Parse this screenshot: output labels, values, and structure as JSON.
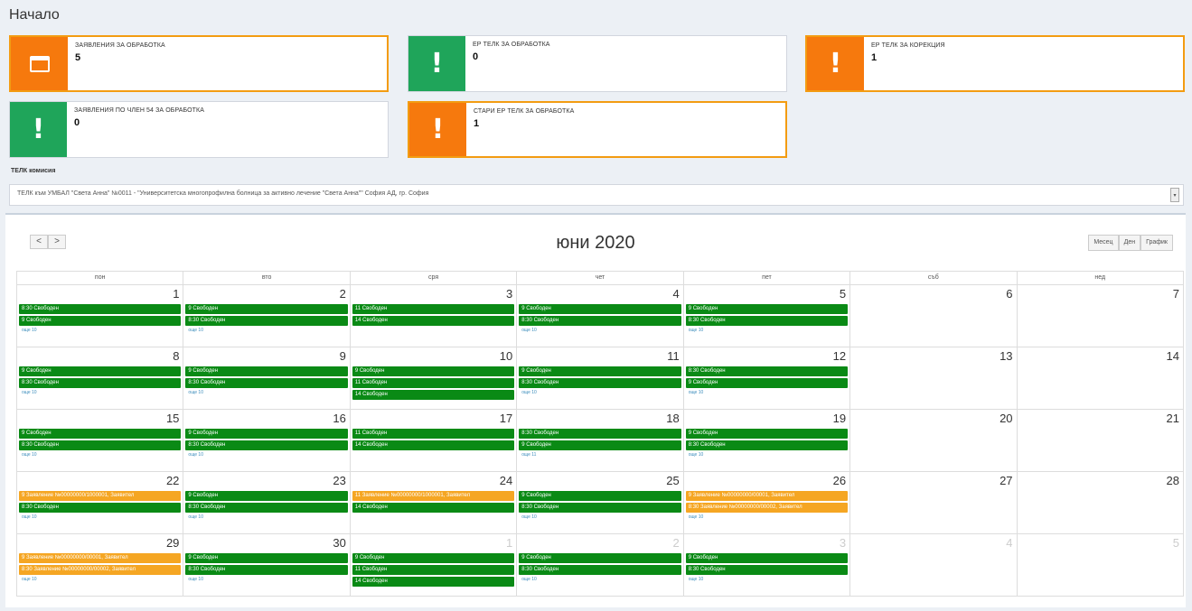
{
  "page": {
    "title": "Начало"
  },
  "boxes": [
    {
      "label": "ЗАЯВЛЕНИЯ ЗА ОБРАБОТКА",
      "count": "5",
      "color": "#f6790d",
      "icon": "calendar-icon"
    },
    {
      "label": "ЕР ТЕЛК ЗА ОБРАБОТКА",
      "count": "0",
      "color": "#1fa55a",
      "icon": "exclamation-icon"
    },
    {
      "label": "ЕР ТЕЛК ЗА КОРЕКЦИЯ",
      "count": "1",
      "color": "#f6790d",
      "icon": "exclamation-icon"
    },
    {
      "label": "ЗАЯВЛЕНИЯ ПО ЧЛЕН 54 ЗА ОБРАБОТКА",
      "count": "0",
      "color": "#1fa55a",
      "icon": "exclamation-icon"
    },
    {
      "label": "СТАРИ ЕР ТЕЛК ЗА ОБРАБОТКА",
      "count": "1",
      "color": "#f6790d",
      "icon": "exclamation-icon"
    }
  ],
  "telk": {
    "label": "ТЕЛК комисия",
    "selected": "ТЕЛК към УМБАЛ \"Света Анна\" №0011 - \"Университетска многопрофилна болница за активно лечение \"Света Анна\"\" София АД, гр. София"
  },
  "calendar": {
    "title": "юни 2020",
    "prev": "<",
    "next": ">",
    "views": [
      "Месец",
      "Ден",
      "График"
    ],
    "dow": [
      "пон",
      "вто",
      "сря",
      "чет",
      "пет",
      "съб",
      "нед"
    ],
    "weeks": [
      [
        {
          "day": "1",
          "events": [
            {
              "t": "8:30 Свободен",
              "c": "g"
            },
            {
              "t": "9 Свободен",
              "c": "g"
            }
          ],
          "more": "още 10"
        },
        {
          "day": "2",
          "events": [
            {
              "t": "9 Свободен",
              "c": "g"
            },
            {
              "t": "8:30 Свободен",
              "c": "g"
            }
          ],
          "more": "още 10"
        },
        {
          "day": "3",
          "events": [
            {
              "t": "11 Свободен",
              "c": "g"
            },
            {
              "t": "14 Свободен",
              "c": "g"
            }
          ],
          "more": ""
        },
        {
          "day": "4",
          "events": [
            {
              "t": "9 Свободен",
              "c": "g"
            },
            {
              "t": "8:30 Свободен",
              "c": "g"
            }
          ],
          "more": "още 10"
        },
        {
          "day": "5",
          "events": [
            {
              "t": "9 Свободен",
              "c": "g"
            },
            {
              "t": "8:30 Свободен",
              "c": "g"
            }
          ],
          "more": "още 10"
        },
        {
          "day": "6",
          "events": [],
          "more": ""
        },
        {
          "day": "7",
          "events": [],
          "more": ""
        }
      ],
      [
        {
          "day": "8",
          "events": [
            {
              "t": "9 Свободен",
              "c": "g"
            },
            {
              "t": "8:30 Свободен",
              "c": "g"
            }
          ],
          "more": "още 10"
        },
        {
          "day": "9",
          "events": [
            {
              "t": "9 Свободен",
              "c": "g"
            },
            {
              "t": "8:30 Свободен",
              "c": "g"
            }
          ],
          "more": "още 10"
        },
        {
          "day": "10",
          "events": [
            {
              "t": "9 Свободен",
              "c": "g"
            },
            {
              "t": "11 Свободен",
              "c": "g"
            },
            {
              "t": "14 Свободен",
              "c": "g"
            }
          ],
          "more": ""
        },
        {
          "day": "11",
          "events": [
            {
              "t": "9 Свободен",
              "c": "g"
            },
            {
              "t": "8:30 Свободен",
              "c": "g"
            }
          ],
          "more": "още 10"
        },
        {
          "day": "12",
          "events": [
            {
              "t": "8:30 Свободен",
              "c": "g"
            },
            {
              "t": "9 Свободен",
              "c": "g"
            }
          ],
          "more": "още 10"
        },
        {
          "day": "13",
          "events": [],
          "more": ""
        },
        {
          "day": "14",
          "events": [],
          "more": ""
        }
      ],
      [
        {
          "day": "15",
          "events": [
            {
              "t": "9 Свободен",
              "c": "g"
            },
            {
              "t": "8:30 Свободен",
              "c": "g"
            }
          ],
          "more": "още 10"
        },
        {
          "day": "16",
          "events": [
            {
              "t": "9 Свободен",
              "c": "g"
            },
            {
              "t": "8:30 Свободен",
              "c": "g"
            }
          ],
          "more": "още 10"
        },
        {
          "day": "17",
          "events": [
            {
              "t": "11 Свободен",
              "c": "g"
            },
            {
              "t": "14 Свободен",
              "c": "g"
            }
          ],
          "more": ""
        },
        {
          "day": "18",
          "events": [
            {
              "t": "8:30 Свободен",
              "c": "g"
            },
            {
              "t": "9 Свободен",
              "c": "g"
            }
          ],
          "more": "още 11"
        },
        {
          "day": "19",
          "events": [
            {
              "t": "9 Свободен",
              "c": "g"
            },
            {
              "t": "8:30 Свободен",
              "c": "g"
            }
          ],
          "more": "още 10"
        },
        {
          "day": "20",
          "events": [],
          "more": ""
        },
        {
          "day": "21",
          "events": [],
          "more": ""
        }
      ],
      [
        {
          "day": "22",
          "events": [
            {
              "t": "9 Заявление №00000000/1000001, Заявител",
              "c": "o"
            },
            {
              "t": "8:30 Свободен",
              "c": "g"
            }
          ],
          "more": "още 10"
        },
        {
          "day": "23",
          "events": [
            {
              "t": "9 Свободен",
              "c": "g"
            },
            {
              "t": "8:30 Свободен",
              "c": "g"
            }
          ],
          "more": "още 10"
        },
        {
          "day": "24",
          "events": [
            {
              "t": "11 Заявление №00000000/1000001, Заявител",
              "c": "o"
            },
            {
              "t": "14 Свободен",
              "c": "g"
            }
          ],
          "more": ""
        },
        {
          "day": "25",
          "events": [
            {
              "t": "9 Свободен",
              "c": "g"
            },
            {
              "t": "8:30 Свободен",
              "c": "g"
            }
          ],
          "more": "още 10"
        },
        {
          "day": "26",
          "events": [
            {
              "t": "9 Заявление №00000000/00001, Заявител",
              "c": "o"
            },
            {
              "t": "8:30 Заявление №00000000/00002, Заявител",
              "c": "o"
            }
          ],
          "more": "още 10"
        },
        {
          "day": "27",
          "events": [],
          "more": ""
        },
        {
          "day": "28",
          "events": [],
          "more": ""
        }
      ],
      [
        {
          "day": "29",
          "events": [
            {
              "t": "9 Заявление №00000000/00001, Заявител",
              "c": "o"
            },
            {
              "t": "8:30 Заявление №00000000/00002, Заявител",
              "c": "o"
            }
          ],
          "more": "още 10"
        },
        {
          "day": "30",
          "events": [
            {
              "t": "9 Свободен",
              "c": "g"
            },
            {
              "t": "8:30 Свободен",
              "c": "g"
            }
          ],
          "more": "още 10"
        },
        {
          "day": "1",
          "other": true,
          "events": [
            {
              "t": "9 Свободен",
              "c": "g"
            },
            {
              "t": "11 Свободен",
              "c": "g"
            },
            {
              "t": "14 Свободен",
              "c": "g"
            }
          ],
          "more": ""
        },
        {
          "day": "2",
          "other": true,
          "events": [
            {
              "t": "9 Свободен",
              "c": "g"
            },
            {
              "t": "8:30 Свободен",
              "c": "g"
            }
          ],
          "more": "още 10"
        },
        {
          "day": "3",
          "other": true,
          "events": [
            {
              "t": "9 Свободен",
              "c": "g"
            },
            {
              "t": "8:30 Свободен",
              "c": "g"
            }
          ],
          "more": "още 10"
        },
        {
          "day": "4",
          "other": true,
          "events": [],
          "more": ""
        },
        {
          "day": "5",
          "other": true,
          "events": [],
          "more": ""
        }
      ]
    ]
  }
}
